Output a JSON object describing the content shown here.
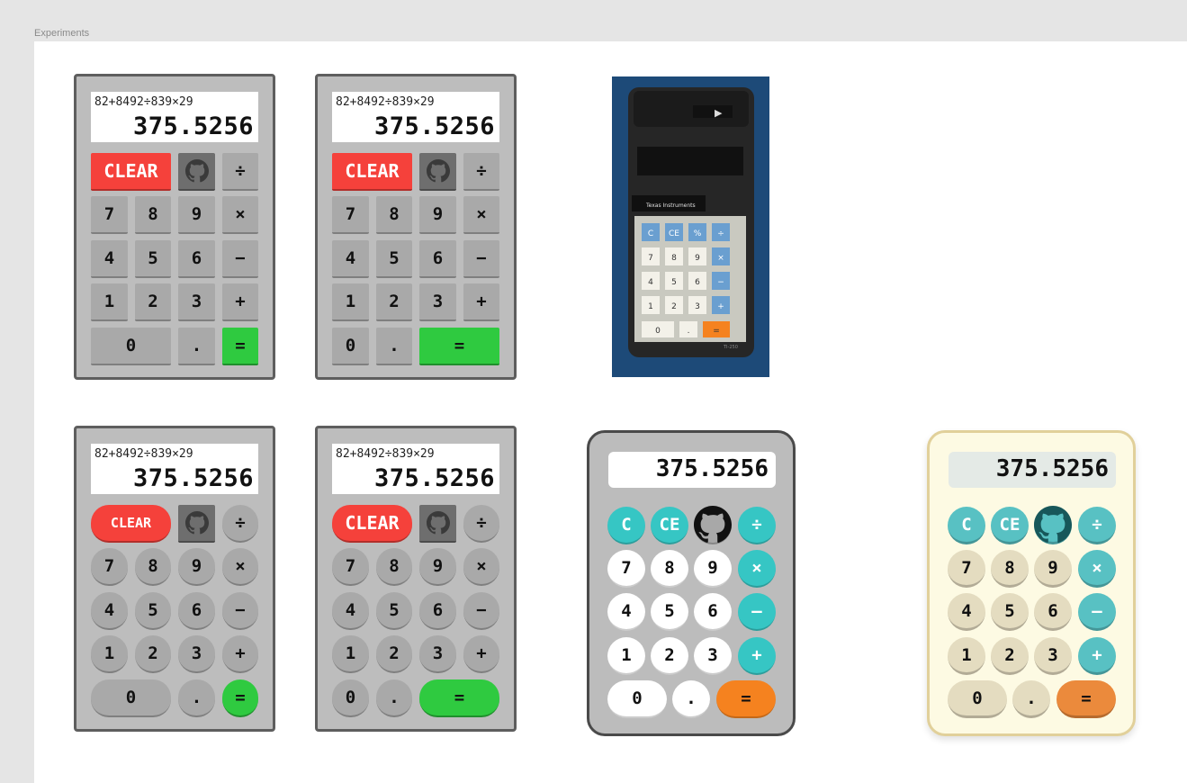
{
  "page": {
    "label": "Experiments"
  },
  "display": {
    "expression": "82+8492÷839×29",
    "result": "375.5256"
  },
  "keys": {
    "clear": "CLEAR",
    "c": "C",
    "ce": "CE",
    "pct": "%",
    "divide": "÷",
    "multiply": "×",
    "minus": "−",
    "plus": "+",
    "equals": "=",
    "dot": ".",
    "d0": "0",
    "d1": "1",
    "d2": "2",
    "d3": "3",
    "d4": "4",
    "d5": "5",
    "d6": "6",
    "d7": "7",
    "d8": "8",
    "d9": "9",
    "modern_minus": "–"
  },
  "photo": {
    "brand": "Texas Instruments",
    "model": "TI-250",
    "play": "▶",
    "product": "Texas Instruments TI-250"
  },
  "icons": {
    "github": "github-icon"
  },
  "colors": {
    "clear": "#f5413b",
    "equals": "#2fca40",
    "teal": "#36c6c4",
    "orange": "#f5821f",
    "body_gray": "#bdbdbd",
    "cream": "#fdfae3"
  }
}
